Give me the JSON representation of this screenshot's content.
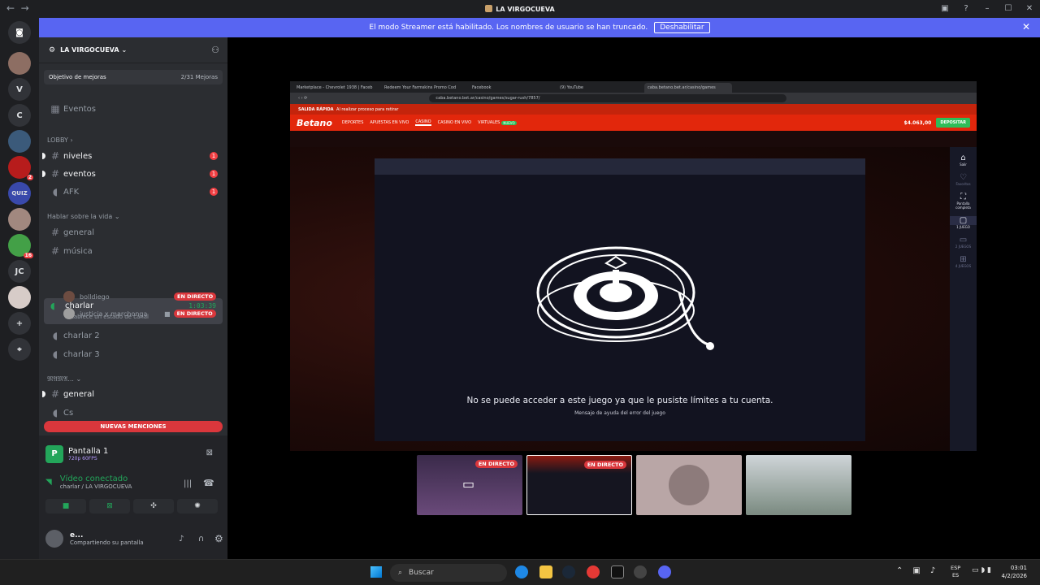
{
  "window": {
    "title": "LA VIRGOCUEVA",
    "back_icon": "arrow-left-icon",
    "forward_icon": "arrow-right-icon",
    "inbox_icon": "inbox-icon",
    "help_icon": "help-icon",
    "minimize": "–",
    "maximize": "☐",
    "close": "✕"
  },
  "streamer_banner": {
    "text": "El modo Streamer está habilitado. Los nombres de usuario se han truncado.",
    "button": "Deshabilitar",
    "close": "✕"
  },
  "server_rail": {
    "items": [
      {
        "label": "V",
        "name": "server-v"
      },
      {
        "label": "C",
        "name": "server-c"
      },
      {
        "label": "QUIZ",
        "name": "server-quiz"
      },
      {
        "label": "JC",
        "name": "server-jc"
      },
      {
        "label": "+",
        "name": "add-server"
      },
      {
        "label": "⌖",
        "name": "discover"
      }
    ],
    "badges": [
      "2",
      "16"
    ]
  },
  "guild": {
    "name": "LA VIRGOCUEVA",
    "goal_label": "Objetivo de mejoras",
    "goal_progress": "2/31 Mejoras",
    "events": "Eventos"
  },
  "categories": {
    "lobby": "LOBBY",
    "hablar": "Hablar sobre la vida",
    "other": "𝔐𝔄𝔐𝔄..."
  },
  "channels": {
    "niveles": {
      "name": "niveles",
      "count": "1"
    },
    "eventos": {
      "name": "eventos",
      "count": "1"
    },
    "afk": {
      "name": "AFK",
      "count": "1"
    },
    "general": "general",
    "musica": "música",
    "charlar": {
      "name": "charlar",
      "timer": "1:03:39",
      "status": "Establece un estado de canal"
    },
    "charlar2": "charlar 2",
    "charlar3": "charlar 3",
    "general2": "general",
    "cs": "Cs"
  },
  "voice_members": [
    {
      "name": "bolldiego",
      "live": "EN DIRECTO"
    },
    {
      "name": "justicia x marchonga",
      "live": "EN DIRECTO"
    }
  ],
  "new_mentions": "NUEVAS MENCIONES",
  "screen_panel": {
    "title": "Pantalla 1",
    "quality": "720p 60FPS",
    "status": "Vídeo conectado",
    "location": "charlar / LA VIRGOCUEVA",
    "user": "e...",
    "user_status": "Compartiendo su pantalla"
  },
  "browser": {
    "tabs": [
      "Marketplace - Chevrolet 1938 | Faceb",
      "Redeem Your Farmskins Promo Cod",
      "Facebook",
      "(9) YouTube",
      "caba.betano.bet.ar/casino/games"
    ],
    "url": "caba.betano.bet.ar/casino/games/sugar-rush/7857/",
    "promo_title": "SALIDA RÁPIDA",
    "promo_sub": "Al realizar proceso para retirar",
    "logo": "Betano",
    "nav": [
      "DEPORTES",
      "APUESTAS EN VIVO",
      "CASINO",
      "CASINO EN VIVO",
      "VIRTUALES"
    ],
    "new_badge": "NUEVO",
    "balance": "$4.063,00",
    "deposit": "DEPOSITAR",
    "error_message": "No se puede acceder a este juego ya que le pusiste límites a tu cuenta.",
    "error_help": "Mensaje de ayuda del error del juego",
    "side": [
      "Salir",
      "Favoritos",
      "Pantalla completa",
      "1 JUEGO",
      "2 JUEGOS",
      "4 JUEGOS"
    ]
  },
  "stream_thumbs": [
    {
      "live": "EN DIRECTO"
    },
    {
      "live": "EN DIRECTO"
    },
    {
      "live": ""
    },
    {
      "live": ""
    }
  ],
  "taskbar": {
    "search": "Buscar",
    "lang_top": "ESP",
    "lang_bottom": "ES",
    "time": "03:01",
    "date": "4/2/2026"
  },
  "colors": {
    "discord_blurple": "#5865f2",
    "live_red": "#da373c",
    "betano_orange": "#e2270c",
    "connected_green": "#23a55a"
  }
}
